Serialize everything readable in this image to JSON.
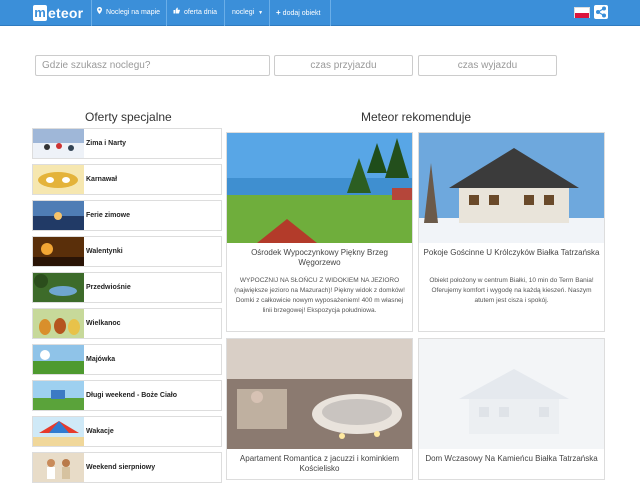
{
  "brand": {
    "logo_letter": "m",
    "logo_text": "eteor"
  },
  "nav": {
    "map": "Noclegi na mapie",
    "offer_day": "oferta dnia",
    "lodging": "noclegi",
    "add": "dodaj obiekt"
  },
  "search": {
    "placeholder": "Gdzie szukasz noclegu?",
    "arrival": "czas przyjazdu",
    "departure": "czas wyjazdu"
  },
  "special": {
    "title": "Oferty specjalne",
    "items": [
      {
        "label": "Zima i Narty"
      },
      {
        "label": "Karnawał"
      },
      {
        "label": "Ferie zimowe"
      },
      {
        "label": "Walentynki"
      },
      {
        "label": "Przedwiośnie"
      },
      {
        "label": "Wielkanoc"
      },
      {
        "label": "Majówka"
      },
      {
        "label": "Długi weekend - Boże Ciało"
      },
      {
        "label": "Wakacje"
      },
      {
        "label": "Weekend sierpniowy"
      }
    ]
  },
  "recommend": {
    "title": "Meteor rekomenduje",
    "cards": [
      {
        "title": "Ośrodek Wypoczynkowy Piękny Brzeg Węgorzewo",
        "desc": "WYPOCZNIJ NA SŁOŃCU Z WIDOKIEM NA JEZIORO (największe jezioro na Mazurach)! Piękny widok z domków! Domki z całkowicie nowym wyposażeniem! 400 m własnej linii brzegowej! Ekspozycja południowa."
      },
      {
        "title": "Pokoje Gościnne U Królczyków Białka Tatrzańska",
        "desc": "Obiekt położony w centrum Białki, 10 min do Term Bania! Oferujemy komfort i wygodę na każdą kieszeń. Naszym atutem jest cisza i spokój."
      },
      {
        "title": "Apartament Romantica z jacuzzi i kominkiem Kościelisko",
        "desc": ""
      },
      {
        "title": "Dom Wczasowy Na Kamieńcu Białka Tatrzańska",
        "desc": ""
      }
    ]
  },
  "colors": {
    "navbar": "#3b8fd9",
    "accent": "#ffffff"
  }
}
